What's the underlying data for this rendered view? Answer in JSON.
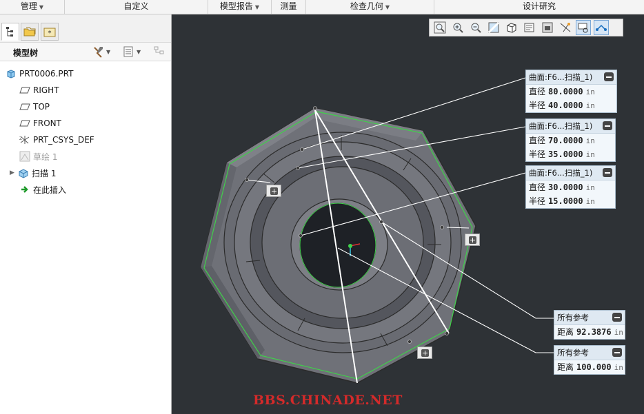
{
  "menubar": {
    "items": [
      {
        "label": "管理",
        "caret": true
      },
      {
        "label": "自定义",
        "caret": false
      },
      {
        "label": "模型报告",
        "caret": true
      },
      {
        "label": "测量",
        "caret": false
      },
      {
        "label": "检查几何",
        "caret": true
      },
      {
        "label": "设计研究",
        "caret": false
      }
    ]
  },
  "tree": {
    "title": "模型树",
    "nodes": [
      {
        "label": "PRT0006.PRT",
        "icon": "part-icon"
      },
      {
        "label": "RIGHT",
        "icon": "datum-plane-icon"
      },
      {
        "label": "TOP",
        "icon": "datum-plane-icon"
      },
      {
        "label": "FRONT",
        "icon": "datum-plane-icon"
      },
      {
        "label": "PRT_CSYS_DEF",
        "icon": "csys-icon"
      },
      {
        "label": "草绘 1",
        "icon": "sketch-icon",
        "dimmed": true
      },
      {
        "label": "扫描 1",
        "icon": "sweep-icon",
        "expander": true
      },
      {
        "label": "在此插入",
        "icon": "insert-here-icon"
      }
    ]
  },
  "measures": [
    {
      "title": "曲面:F6...扫描_1)",
      "rows": [
        {
          "label": "直径",
          "value": "80.0000",
          "unit": "in"
        },
        {
          "label": "半径",
          "value": "40.0000",
          "unit": "in"
        }
      ]
    },
    {
      "title": "曲面:F6...扫描_1)",
      "rows": [
        {
          "label": "直径",
          "value": "70.0000",
          "unit": "in"
        },
        {
          "label": "半径",
          "value": "35.0000",
          "unit": "in"
        }
      ]
    },
    {
      "title": "曲面:F6...扫描_1)",
      "rows": [
        {
          "label": "直径",
          "value": "30.0000",
          "unit": "in"
        },
        {
          "label": "半径",
          "value": "15.0000",
          "unit": "in"
        }
      ]
    },
    {
      "title": "所有参考",
      "rows": [
        {
          "label": "距离",
          "value": "92.3876",
          "unit": "in"
        }
      ]
    },
    {
      "title": "所有参考",
      "rows": [
        {
          "label": "距离",
          "value": "100.000",
          "unit": "in"
        }
      ]
    }
  ],
  "view_toolbar": {
    "icons": [
      "zoom-fit-icon",
      "zoom-in-icon",
      "zoom-out-icon",
      "repaint-icon",
      "display-style-icon",
      "saved-views-icon",
      "view-manager-icon",
      "datum-display-icon",
      "annotation-display-icon",
      "spin-center-icon"
    ]
  },
  "watermark": "BBS.CHINADE.NET",
  "colors": {
    "model": "#6f7178",
    "edge": "#2b2b2b",
    "highlight": "#3fd14a",
    "leader": "#ffffff"
  }
}
